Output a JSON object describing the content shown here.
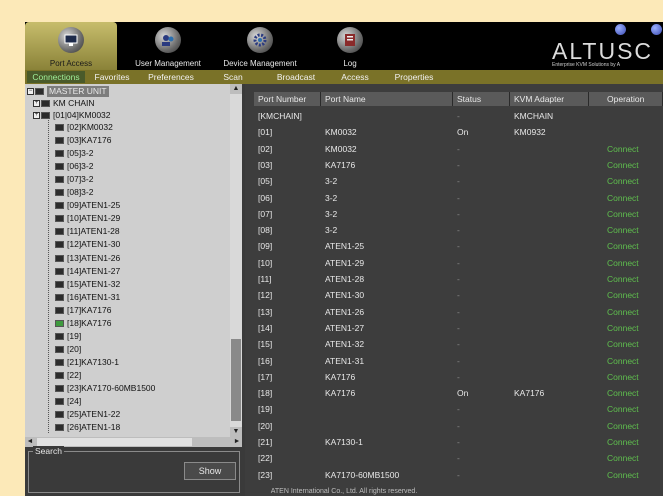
{
  "topbar": {
    "port_access": "Port Access",
    "user_management": "User Management",
    "device_management": "Device Management",
    "log": "Log",
    "brand": "ALTUSC",
    "tagline": "Enterprise KVM Solutions by A"
  },
  "tabs": [
    "Connections",
    "Favorites",
    "Preferences",
    "Scan",
    "Broadcast",
    "Access",
    "Properties"
  ],
  "tree": {
    "root": "MASTER UNIT",
    "chain": "KM CHAIN",
    "group": "[01|04]KM0032",
    "items": [
      "[02]KM0032",
      "[03]KA7176",
      "[05]3-2",
      "[06]3-2",
      "[07]3-2",
      "[08]3-2",
      "[09]ATEN1-25",
      "[10]ATEN1-29",
      "[11]ATEN1-28",
      "[12]ATEN1-30",
      "[13]ATEN1-26",
      "[14]ATEN1-27",
      "[15]ATEN1-32",
      "[16]ATEN1-31",
      "[17]KA7176",
      "[18]KA7176",
      "[19]",
      "[20]",
      "[21]KA7130-1",
      "[22]",
      "[23]KA7170-60MB1500",
      "[24]",
      "[25]ATEN1-22",
      "[26]ATEN1-18"
    ]
  },
  "search": {
    "label": "Search",
    "value": "",
    "show_button": "Show"
  },
  "table": {
    "headers": [
      "Port Number",
      "Port Name",
      "Status",
      "KVM Adapter",
      "Operation"
    ],
    "rows": [
      [
        "[KMCHAIN]",
        "",
        "-",
        "KMCHAIN",
        ""
      ],
      [
        "[01]",
        "KM0032",
        "On",
        "KM0932",
        ""
      ],
      [
        "[02]",
        "KM0032",
        "-",
        "",
        "Connect"
      ],
      [
        "[03]",
        "KA7176",
        "-",
        "",
        "Connect"
      ],
      [
        "[05]",
        "3-2",
        "-",
        "",
        "Connect"
      ],
      [
        "[06]",
        "3-2",
        "-",
        "",
        "Connect"
      ],
      [
        "[07]",
        "3-2",
        "-",
        "",
        "Connect"
      ],
      [
        "[08]",
        "3-2",
        "-",
        "",
        "Connect"
      ],
      [
        "[09]",
        "ATEN1-25",
        "-",
        "",
        "Connect"
      ],
      [
        "[10]",
        "ATEN1-29",
        "-",
        "",
        "Connect"
      ],
      [
        "[11]",
        "ATEN1-28",
        "-",
        "",
        "Connect"
      ],
      [
        "[12]",
        "ATEN1-30",
        "-",
        "",
        "Connect"
      ],
      [
        "[13]",
        "ATEN1-26",
        "-",
        "",
        "Connect"
      ],
      [
        "[14]",
        "ATEN1-27",
        "-",
        "",
        "Connect"
      ],
      [
        "[15]",
        "ATEN1-32",
        "-",
        "",
        "Connect"
      ],
      [
        "[16]",
        "ATEN1-31",
        "-",
        "",
        "Connect"
      ],
      [
        "[17]",
        "KA7176",
        "-",
        "",
        "Connect"
      ],
      [
        "[18]",
        "KA7176",
        "On",
        "KA7176",
        "Connect"
      ],
      [
        "[19]",
        "",
        "-",
        "",
        "Connect"
      ],
      [
        "[20]",
        "",
        "-",
        "",
        "Connect"
      ],
      [
        "[21]",
        "KA7130-1",
        "-",
        "",
        "Connect"
      ],
      [
        "[22]",
        "",
        "-",
        "",
        "Connect"
      ],
      [
        "[23]",
        "KA7170-60MB1500",
        "-",
        "",
        "Connect"
      ]
    ]
  },
  "footer": "ATEN International Co., Ltd. All rights reserved.",
  "colors": {
    "accent": "#5fbf4e",
    "tab_bar": "#7a7228",
    "brand_tab": "#c7bd6c"
  },
  "icons": {
    "port_access": "monitor-hand-icon",
    "user_management": "users-icon",
    "device_management": "gear-icon",
    "log": "log-book-icon"
  }
}
